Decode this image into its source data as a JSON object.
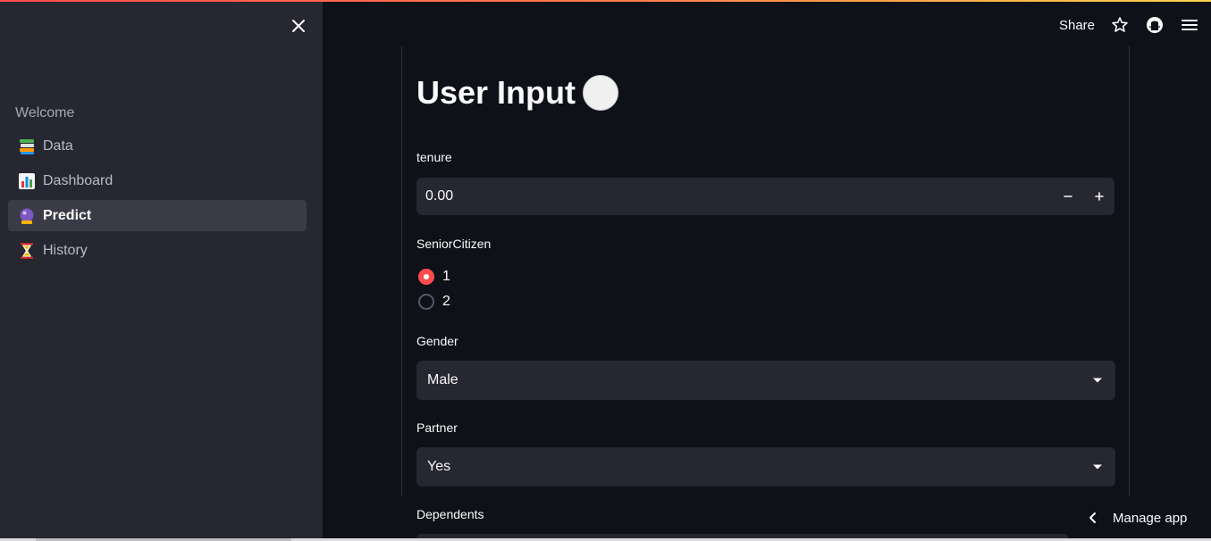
{
  "sidebar": {
    "welcome_label": "Welcome",
    "items": [
      {
        "label": "Data",
        "icon": "books-icon",
        "active": false
      },
      {
        "label": "Dashboard",
        "icon": "bar-chart-icon",
        "active": false
      },
      {
        "label": "Predict",
        "icon": "crystal-ball-icon",
        "active": true
      },
      {
        "label": "History",
        "icon": "hourglass-icon",
        "active": false
      }
    ]
  },
  "header": {
    "share_label": "Share"
  },
  "main": {
    "title": "User Input",
    "tenure": {
      "label": "tenure",
      "value": "0.00",
      "minus": "−",
      "plus": "+"
    },
    "senior_citizen": {
      "label": "SeniorCitizen",
      "options": [
        "1",
        "2"
      ],
      "selected": "1"
    },
    "gender": {
      "label": "Gender",
      "value": "Male"
    },
    "partner": {
      "label": "Partner",
      "value": "Yes"
    },
    "dependents": {
      "label": "Dependents"
    }
  },
  "footer": {
    "manage_app_label": "Manage app"
  },
  "colors": {
    "accent": "#ff4b4b",
    "background": "#0e1117",
    "sidebar": "#262730"
  }
}
